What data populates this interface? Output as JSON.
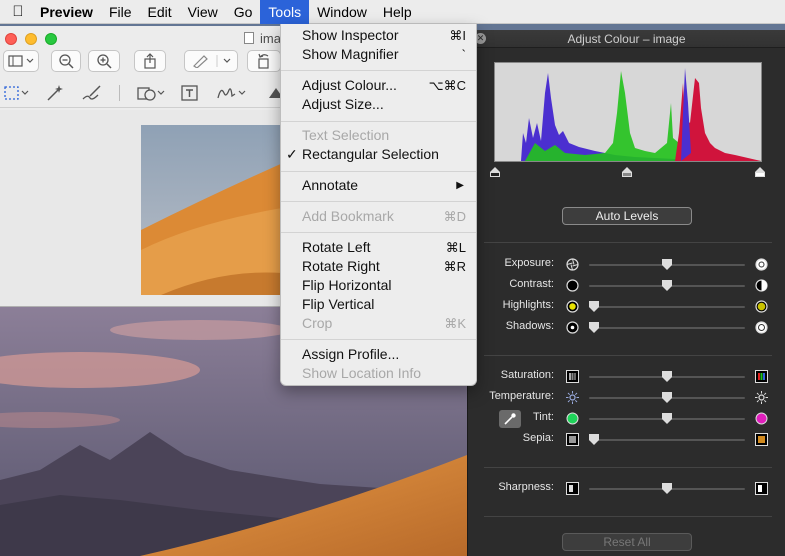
{
  "menubar": {
    "app_name": "Preview",
    "items": [
      "File",
      "Edit",
      "View",
      "Go",
      "Tools",
      "Window",
      "Help"
    ],
    "active": "Tools"
  },
  "preview_window": {
    "title": "ima"
  },
  "tools_menu": {
    "items": [
      {
        "label": "Show Inspector",
        "shortcut": "⌘I",
        "disabled": false
      },
      {
        "label": "Show Magnifier",
        "shortcut": "`",
        "disabled": false
      },
      {
        "label": "Adjust Colour...",
        "shortcut": "⌥⌘C",
        "disabled": false
      },
      {
        "label": "Adjust Size...",
        "shortcut": "",
        "disabled": false
      },
      {
        "label": "Text Selection",
        "shortcut": "",
        "disabled": true
      },
      {
        "label": "Rectangular Selection",
        "shortcut": "",
        "disabled": false,
        "checked": true
      },
      {
        "label": "Annotate",
        "shortcut": "",
        "disabled": false,
        "submenu": true
      },
      {
        "label": "Add Bookmark",
        "shortcut": "⌘D",
        "disabled": true
      },
      {
        "label": "Rotate Left",
        "shortcut": "⌘L",
        "disabled": false
      },
      {
        "label": "Rotate Right",
        "shortcut": "⌘R",
        "disabled": false
      },
      {
        "label": "Flip Horizontal",
        "shortcut": "",
        "disabled": false
      },
      {
        "label": "Flip Vertical",
        "shortcut": "",
        "disabled": false
      },
      {
        "label": "Crop",
        "shortcut": "⌘K",
        "disabled": true
      },
      {
        "label": "Assign Profile...",
        "shortcut": "",
        "disabled": false
      },
      {
        "label": "Show Location Info",
        "shortcut": "",
        "disabled": true
      }
    ],
    "check_glyph": "✓",
    "submenu_glyph": "▶"
  },
  "adjust_colour": {
    "title": "Adjust Colour – image",
    "auto_levels": "Auto Levels",
    "reset_all": "Reset All",
    "sliders": {
      "exposure": {
        "label": "Exposure:",
        "value": 0.5
      },
      "contrast": {
        "label": "Contrast:",
        "value": 0.5
      },
      "highlights": {
        "label": "Highlights:",
        "value": 0.0
      },
      "shadows": {
        "label": "Shadows:",
        "value": 0.0
      },
      "saturation": {
        "label": "Saturation:",
        "value": 0.5
      },
      "temperature": {
        "label": "Temperature:",
        "value": 0.5
      },
      "tint": {
        "label": "Tint:",
        "value": 0.5
      },
      "sepia": {
        "label": "Sepia:",
        "value": 0.0
      },
      "sharpness": {
        "label": "Sharpness:",
        "value": 0.5
      }
    },
    "colors": {
      "histogram_red": "#d0143c",
      "histogram_green": "#22c21c",
      "histogram_blue": "#4b2fd0",
      "highlight_yellow": "#e8e200",
      "tint_green": "#1fd35a",
      "tint_magenta": "#e01fbc",
      "sepia_orange": "#d18a1f"
    }
  }
}
